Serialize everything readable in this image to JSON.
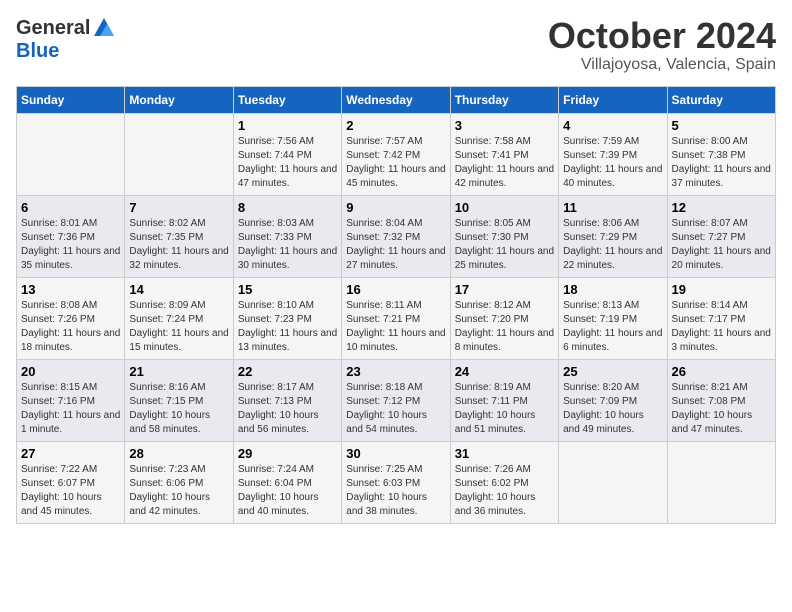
{
  "header": {
    "logo_general": "General",
    "logo_blue": "Blue",
    "month": "October 2024",
    "location": "Villajoyosa, Valencia, Spain"
  },
  "days_of_week": [
    "Sunday",
    "Monday",
    "Tuesday",
    "Wednesday",
    "Thursday",
    "Friday",
    "Saturday"
  ],
  "weeks": [
    [
      {
        "day": "",
        "detail": ""
      },
      {
        "day": "",
        "detail": ""
      },
      {
        "day": "1",
        "detail": "Sunrise: 7:56 AM\nSunset: 7:44 PM\nDaylight: 11 hours and 47 minutes."
      },
      {
        "day": "2",
        "detail": "Sunrise: 7:57 AM\nSunset: 7:42 PM\nDaylight: 11 hours and 45 minutes."
      },
      {
        "day": "3",
        "detail": "Sunrise: 7:58 AM\nSunset: 7:41 PM\nDaylight: 11 hours and 42 minutes."
      },
      {
        "day": "4",
        "detail": "Sunrise: 7:59 AM\nSunset: 7:39 PM\nDaylight: 11 hours and 40 minutes."
      },
      {
        "day": "5",
        "detail": "Sunrise: 8:00 AM\nSunset: 7:38 PM\nDaylight: 11 hours and 37 minutes."
      }
    ],
    [
      {
        "day": "6",
        "detail": "Sunrise: 8:01 AM\nSunset: 7:36 PM\nDaylight: 11 hours and 35 minutes."
      },
      {
        "day": "7",
        "detail": "Sunrise: 8:02 AM\nSunset: 7:35 PM\nDaylight: 11 hours and 32 minutes."
      },
      {
        "day": "8",
        "detail": "Sunrise: 8:03 AM\nSunset: 7:33 PM\nDaylight: 11 hours and 30 minutes."
      },
      {
        "day": "9",
        "detail": "Sunrise: 8:04 AM\nSunset: 7:32 PM\nDaylight: 11 hours and 27 minutes."
      },
      {
        "day": "10",
        "detail": "Sunrise: 8:05 AM\nSunset: 7:30 PM\nDaylight: 11 hours and 25 minutes."
      },
      {
        "day": "11",
        "detail": "Sunrise: 8:06 AM\nSunset: 7:29 PM\nDaylight: 11 hours and 22 minutes."
      },
      {
        "day": "12",
        "detail": "Sunrise: 8:07 AM\nSunset: 7:27 PM\nDaylight: 11 hours and 20 minutes."
      }
    ],
    [
      {
        "day": "13",
        "detail": "Sunrise: 8:08 AM\nSunset: 7:26 PM\nDaylight: 11 hours and 18 minutes."
      },
      {
        "day": "14",
        "detail": "Sunrise: 8:09 AM\nSunset: 7:24 PM\nDaylight: 11 hours and 15 minutes."
      },
      {
        "day": "15",
        "detail": "Sunrise: 8:10 AM\nSunset: 7:23 PM\nDaylight: 11 hours and 13 minutes."
      },
      {
        "day": "16",
        "detail": "Sunrise: 8:11 AM\nSunset: 7:21 PM\nDaylight: 11 hours and 10 minutes."
      },
      {
        "day": "17",
        "detail": "Sunrise: 8:12 AM\nSunset: 7:20 PM\nDaylight: 11 hours and 8 minutes."
      },
      {
        "day": "18",
        "detail": "Sunrise: 8:13 AM\nSunset: 7:19 PM\nDaylight: 11 hours and 6 minutes."
      },
      {
        "day": "19",
        "detail": "Sunrise: 8:14 AM\nSunset: 7:17 PM\nDaylight: 11 hours and 3 minutes."
      }
    ],
    [
      {
        "day": "20",
        "detail": "Sunrise: 8:15 AM\nSunset: 7:16 PM\nDaylight: 11 hours and 1 minute."
      },
      {
        "day": "21",
        "detail": "Sunrise: 8:16 AM\nSunset: 7:15 PM\nDaylight: 10 hours and 58 minutes."
      },
      {
        "day": "22",
        "detail": "Sunrise: 8:17 AM\nSunset: 7:13 PM\nDaylight: 10 hours and 56 minutes."
      },
      {
        "day": "23",
        "detail": "Sunrise: 8:18 AM\nSunset: 7:12 PM\nDaylight: 10 hours and 54 minutes."
      },
      {
        "day": "24",
        "detail": "Sunrise: 8:19 AM\nSunset: 7:11 PM\nDaylight: 10 hours and 51 minutes."
      },
      {
        "day": "25",
        "detail": "Sunrise: 8:20 AM\nSunset: 7:09 PM\nDaylight: 10 hours and 49 minutes."
      },
      {
        "day": "26",
        "detail": "Sunrise: 8:21 AM\nSunset: 7:08 PM\nDaylight: 10 hours and 47 minutes."
      }
    ],
    [
      {
        "day": "27",
        "detail": "Sunrise: 7:22 AM\nSunset: 6:07 PM\nDaylight: 10 hours and 45 minutes."
      },
      {
        "day": "28",
        "detail": "Sunrise: 7:23 AM\nSunset: 6:06 PM\nDaylight: 10 hours and 42 minutes."
      },
      {
        "day": "29",
        "detail": "Sunrise: 7:24 AM\nSunset: 6:04 PM\nDaylight: 10 hours and 40 minutes."
      },
      {
        "day": "30",
        "detail": "Sunrise: 7:25 AM\nSunset: 6:03 PM\nDaylight: 10 hours and 38 minutes."
      },
      {
        "day": "31",
        "detail": "Sunrise: 7:26 AM\nSunset: 6:02 PM\nDaylight: 10 hours and 36 minutes."
      },
      {
        "day": "",
        "detail": ""
      },
      {
        "day": "",
        "detail": ""
      }
    ]
  ]
}
